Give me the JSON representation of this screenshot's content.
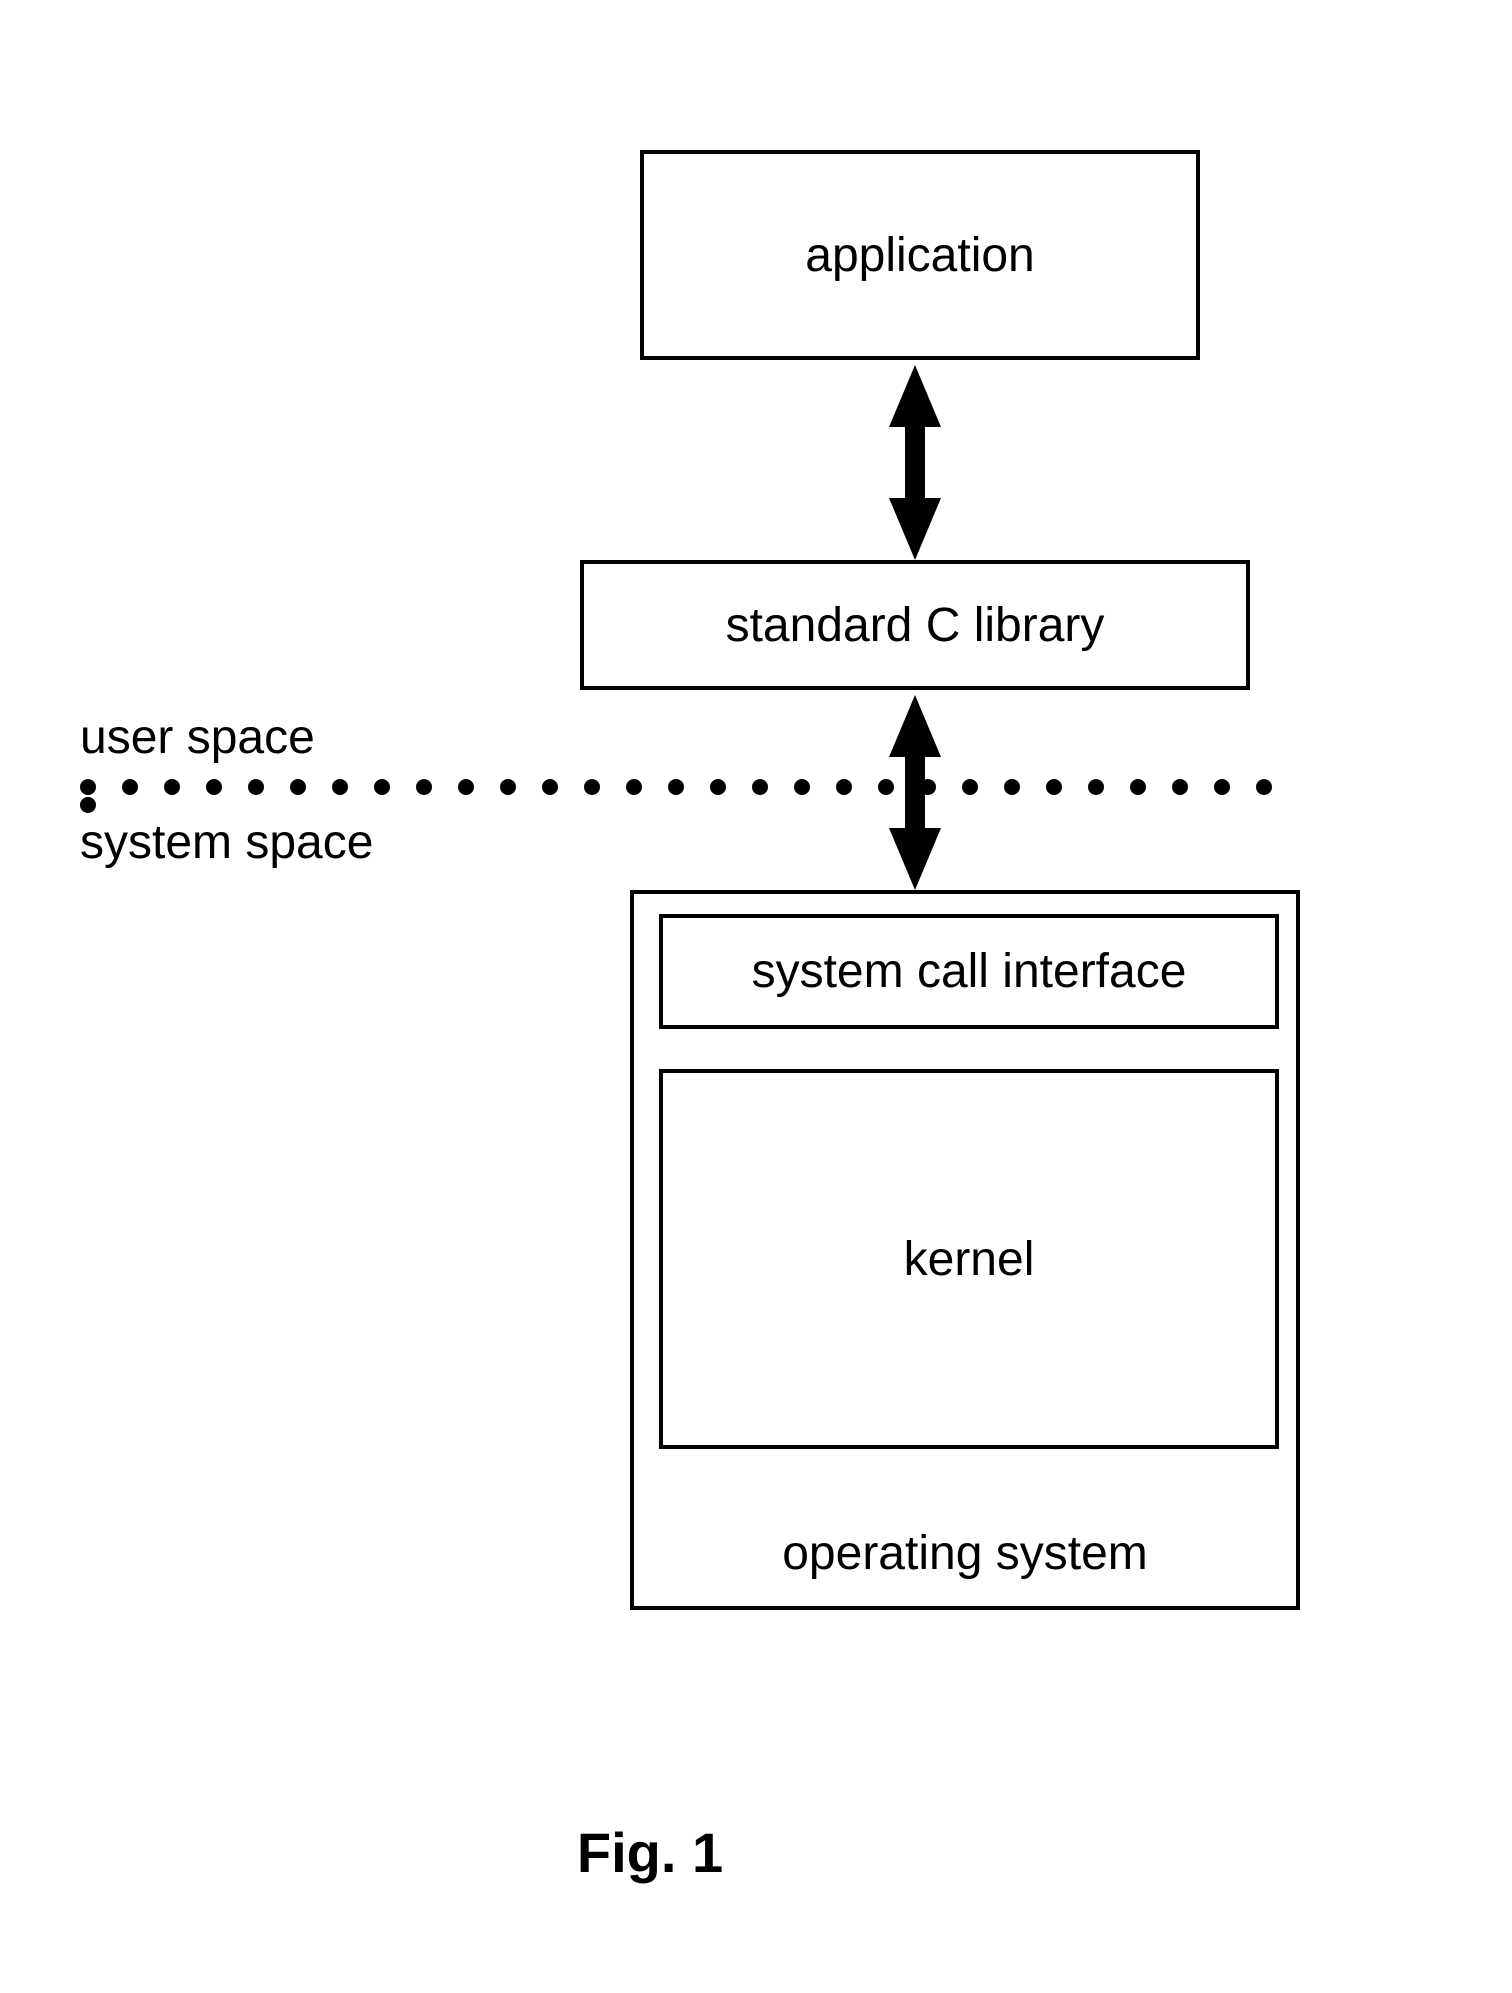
{
  "boxes": {
    "application": "application",
    "library": "standard C library",
    "syscall": "system call interface",
    "kernel": "kernel",
    "os": "operating system"
  },
  "labels": {
    "user_space": "user space",
    "system_space": "system space",
    "figure": "Fig. 1"
  }
}
